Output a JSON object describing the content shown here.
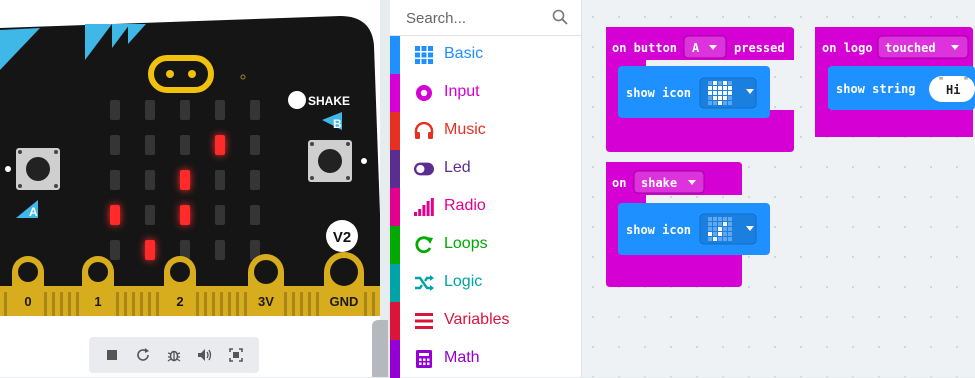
{
  "simulator": {
    "shake_label": "SHAKE",
    "button_a_label": "A",
    "button_b_label": "B",
    "version_badge": "V2",
    "pins": [
      "0",
      "1",
      "2",
      "3V",
      "GND"
    ],
    "led_matrix": [
      [
        0,
        0,
        0,
        0,
        0
      ],
      [
        0,
        0,
        0,
        1,
        0
      ],
      [
        0,
        0,
        1,
        0,
        0
      ],
      [
        1,
        0,
        1,
        0,
        0
      ],
      [
        0,
        1,
        0,
        0,
        0
      ]
    ],
    "colors": {
      "board": "#151515",
      "pin_gold": "#d7ad1e",
      "led_on": "#ff2b2b",
      "led_off": "#353535",
      "logo": "#f0c20d",
      "accent_cyan": "#3fb8e8"
    },
    "toolbar": [
      "stop-icon",
      "restart-icon",
      "debug-icon",
      "mute-icon",
      "fullscreen-icon"
    ]
  },
  "toolbox": {
    "search_placeholder": "Search...",
    "categories": [
      {
        "label": "Basic",
        "color": "#1e90ff",
        "icon": "grid-icon"
      },
      {
        "label": "Input",
        "color": "#d400d4",
        "icon": "radio-dot-icon"
      },
      {
        "label": "Music",
        "color": "#e63022",
        "icon": "headphones-icon"
      },
      {
        "label": "Led",
        "color": "#5c2d91",
        "icon": "toggle-icon"
      },
      {
        "label": "Radio",
        "color": "#e3008c",
        "icon": "signal-bars-icon"
      },
      {
        "label": "Loops",
        "color": "#00aa00",
        "icon": "loop-arrow-icon"
      },
      {
        "label": "Logic",
        "color": "#00a4a6",
        "icon": "shuffle-icon"
      },
      {
        "label": "Variables",
        "color": "#dc143c",
        "icon": "list-icon"
      },
      {
        "label": "Math",
        "color": "#9400d3",
        "icon": "calculator-icon"
      }
    ]
  },
  "workspace": {
    "block_button": {
      "prefix": "on button",
      "dropdown": "A",
      "suffix": "pressed",
      "inner": "show icon"
    },
    "block_logo": {
      "prefix": "on logo",
      "dropdown": "touched",
      "inner": "show string",
      "string_value": "Hi"
    },
    "block_shake": {
      "prefix": "on",
      "dropdown": "shake",
      "inner": "show icon"
    },
    "colors": {
      "event_block": "#d400d4",
      "basic_block": "#1e90ff",
      "workspace_bg": "#eef2f5"
    }
  }
}
